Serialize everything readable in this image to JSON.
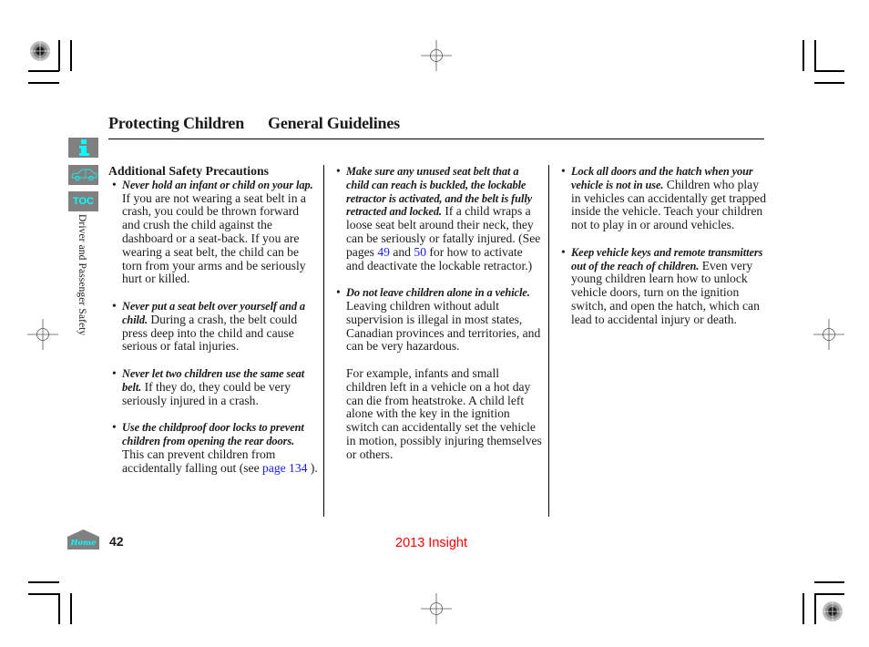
{
  "header": {
    "section_title": "Protecting Children",
    "subsection_title": "General Guidelines"
  },
  "nav": {
    "info_icon": "info-icon",
    "car_icon": "car-icon",
    "toc_label": "TOC",
    "home_label": "Home"
  },
  "side_label": "Driver and Passenger Safety",
  "columns": {
    "left": {
      "heading": "Additional Safety Precautions",
      "items": [
        {
          "lead": "Never hold an infant or child on your lap.",
          "body": " If you are not wearing a seat belt in a crash, you could be thrown forward and crush the child against the dashboard or a seat-back. If you are wearing a seat belt, the child can be torn from your arms and be seriously hurt or killed."
        },
        {
          "lead": "Never put a seat belt over yourself and a child.",
          "body": " During a crash, the belt could press deep into the child and cause serious or fatal injuries."
        },
        {
          "lead": "Never let two children use the same seat belt.",
          "body": " If they do, they could be very seriously injured in a crash."
        },
        {
          "lead": "Use the childproof door locks to prevent children from opening the rear doors.",
          "body": " This can prevent children from accidentally falling out (see ",
          "link": "page 134",
          "tail": " )."
        }
      ]
    },
    "middle": {
      "items": [
        {
          "lead": "Make sure any unused seat belt that a child can reach is buckled, the lockable retractor is activated, and the belt is fully retracted and locked.",
          "body": " If a child wraps a loose seat belt around their neck, they can be seriously or fatally injured. (See pages ",
          "link1": "49",
          "mid": " and ",
          "link2": "50",
          "tail": " for how to activate and deactivate the lockable retractor.)"
        },
        {
          "lead": "Do not leave children alone in a vehicle.",
          "body": " Leaving children without adult supervision is illegal in most states, Canadian provinces and territories, and can be very hazardous."
        }
      ],
      "paragraph": "For example, infants and small children left in a vehicle on a hot day can die from heatstroke. A child left alone with the key in the ignition switch can accidentally set the vehicle in motion, possibly injuring themselves or others."
    },
    "right": {
      "items": [
        {
          "lead": "Lock all doors and the hatch when your vehicle is not in use.",
          "body": " Children who play in vehicles can accidentally get trapped inside the vehicle. Teach your children not to play in or around vehicles."
        },
        {
          "lead": "Keep vehicle keys and remote transmitters out of the reach of children.",
          "body": " Even very young children learn how to unlock vehicle doors, turn on the ignition switch, and open the hatch, which can lead to accidental injury or death."
        }
      ]
    }
  },
  "footer": {
    "page_number": "42",
    "doc_title": "2013 Insight"
  },
  "colors": {
    "nav_bg": "#808080",
    "nav_fg": "#00ffff",
    "link": "#1a1aff",
    "footer_title": "#ff0000"
  }
}
